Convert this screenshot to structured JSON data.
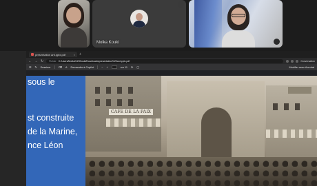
{
  "participants": [
    {
      "name": ""
    },
    {
      "name": "Molka Kouki"
    },
    {
      "name": ""
    }
  ],
  "browser": {
    "tab_title": "presentation ant.pptx.pdf",
    "tab_close": "×",
    "new_tab": "+",
    "url_label": "Fichier",
    "url_path": "C:/Users/Molka%20Kouki/Downloads/presentation%20ant.pptx.pdf",
    "copilot_label": "Conversation"
  },
  "pdf_toolbar": {
    "draw_label": "Dessiner",
    "ask_copilot_label": "Demander à Copilot",
    "page_current": "1",
    "page_total": "sur 11",
    "zoom_out": "−",
    "zoom_in": "+",
    "edit_label": "Modifier avec Acrobat"
  },
  "slide": {
    "lines": [
      "sous le",
      "st construite",
      "de la Marine,",
      "nce Léon"
    ],
    "sign_text": "CAFE DE LA PAIX"
  }
}
